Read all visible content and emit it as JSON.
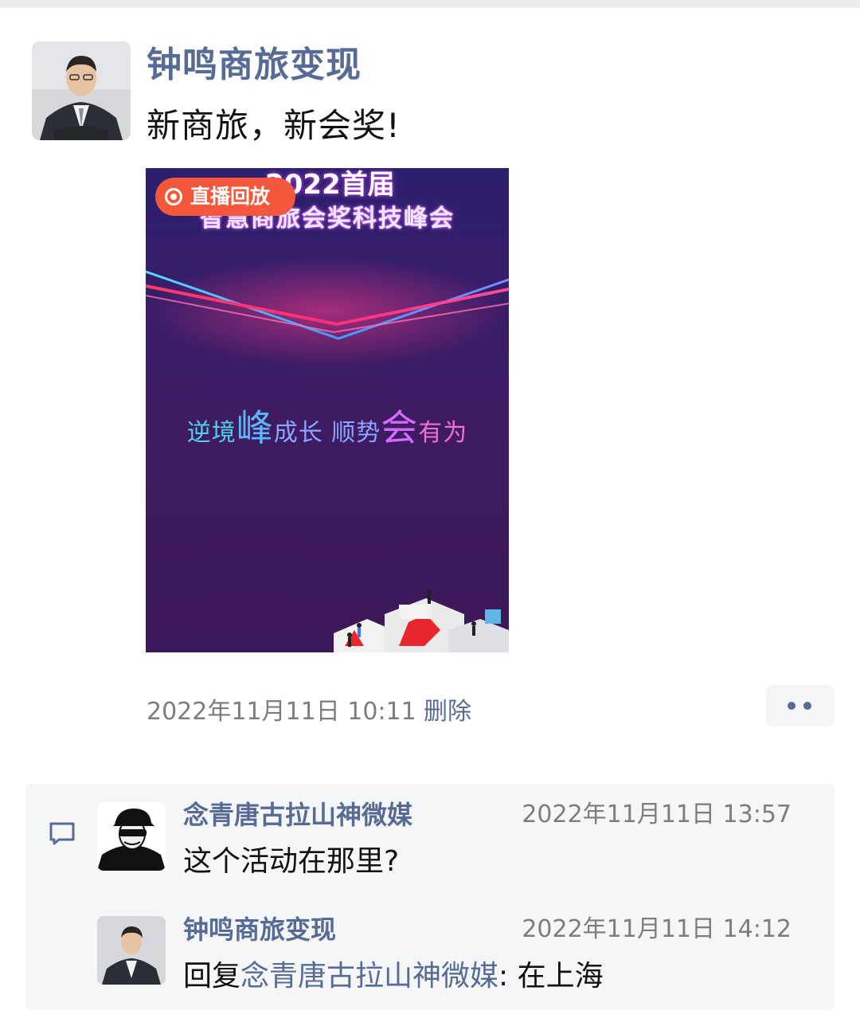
{
  "post": {
    "author": "钟鸣商旅变现",
    "text": "新商旅，新会奖!",
    "timestamp": "2022年11月11日 10:11",
    "delete_label": "删除",
    "more_label": "••"
  },
  "media": {
    "badge": "直播回放",
    "title_line1": "2022首届",
    "title_line2": "智慧商旅会奖科技峰会",
    "slogan": {
      "part1": "逆境",
      "big1": "峰",
      "part2": "成长 顺势",
      "big2": "会",
      "part3": "有为"
    },
    "colors": {
      "background": "#3c1a5e",
      "badge": "#f3583c"
    }
  },
  "comments": [
    {
      "author": "念青唐古拉山神微媒",
      "time": "2022年11月11日 13:57",
      "text": "这个活动在那里?"
    },
    {
      "author": "钟鸣商旅变现",
      "time": "2022年11月11日 14:12",
      "reply_prefix": "回复",
      "reply_to": "念青唐古拉山神微媒",
      "text": ": 在上海"
    }
  ],
  "colors": {
    "link": "#576b95",
    "meta": "#7d7d7d",
    "comment_bg": "#f5f6f8"
  }
}
